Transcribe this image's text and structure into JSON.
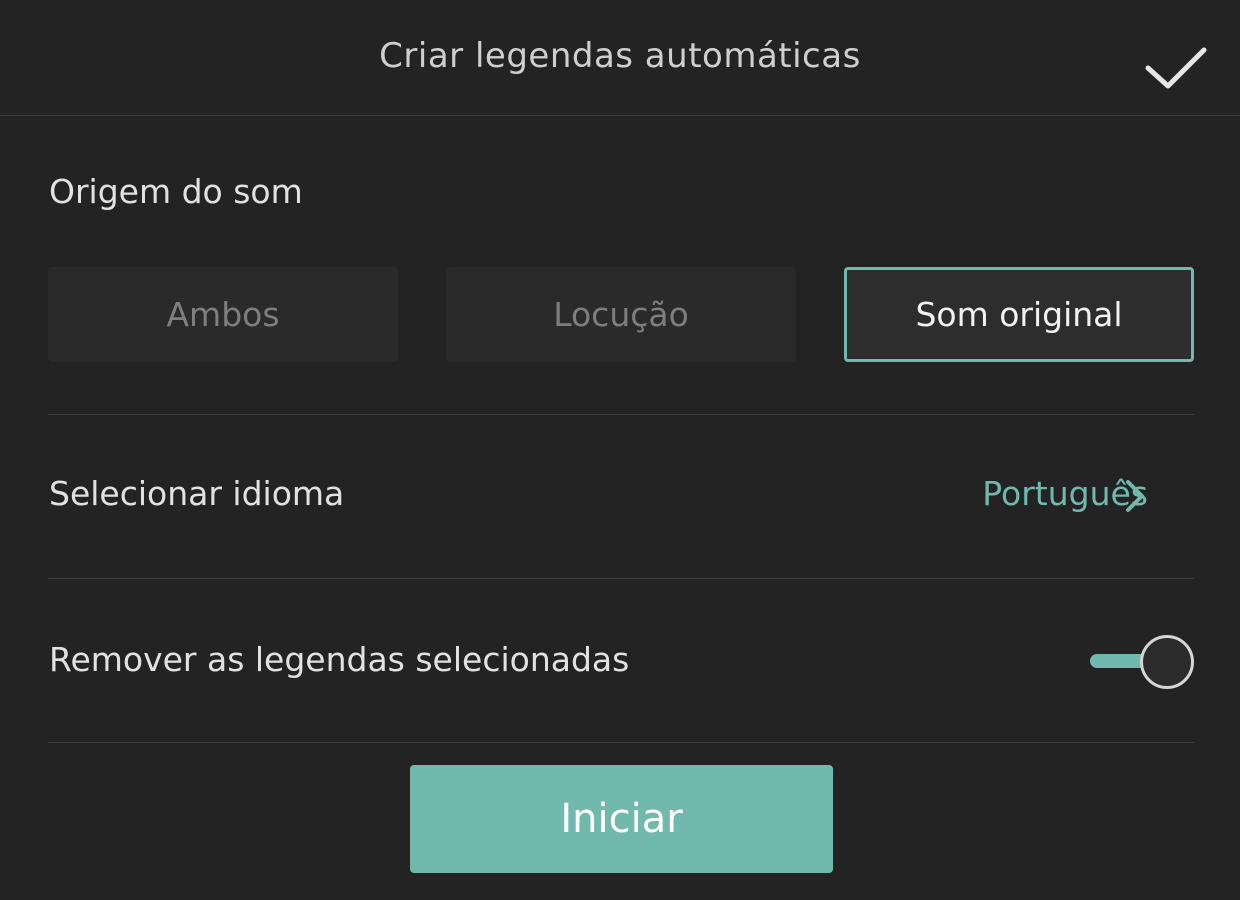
{
  "header": {
    "title": "Criar legendas automáticas",
    "confirm_icon": "checkmark-icon"
  },
  "sound_source": {
    "label": "Origem do som",
    "options": [
      {
        "label": "Ambos",
        "selected": false
      },
      {
        "label": "Locução",
        "selected": false
      },
      {
        "label": "Som original",
        "selected": true
      }
    ]
  },
  "language": {
    "label": "Selecionar idioma",
    "value": "Português",
    "icon": "chevron-right-icon"
  },
  "remove_selected": {
    "label": "Remover as legendas selecionadas",
    "enabled": true
  },
  "start_button": {
    "label": "Iniciar"
  },
  "colors": {
    "accent": "#71b8ad",
    "background": "#232323",
    "segment_bg": "#2a2a2a"
  }
}
